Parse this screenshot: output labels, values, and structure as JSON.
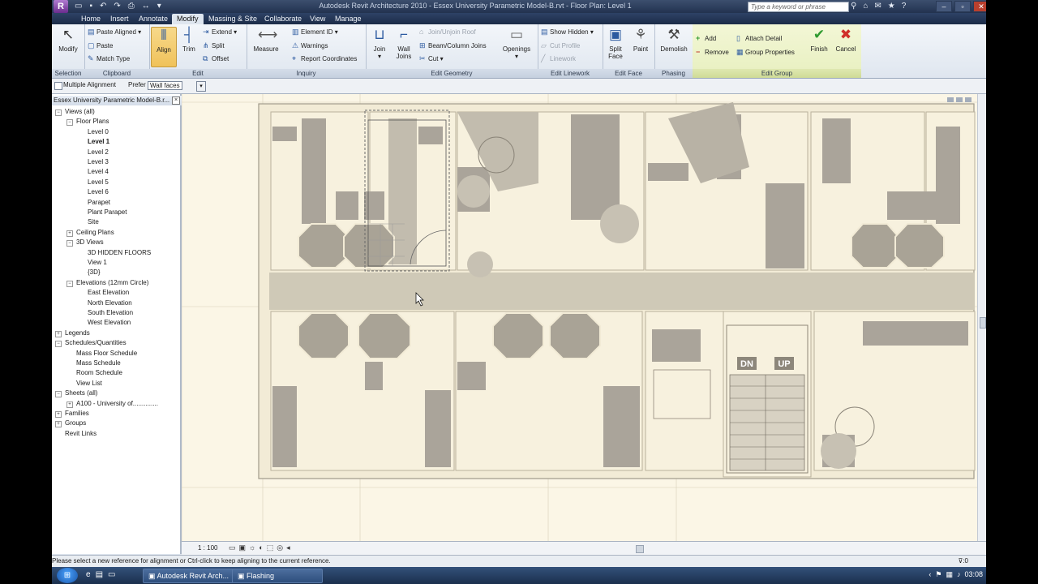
{
  "title_bar": {
    "window_title": "Autodesk Revit Architecture 2010 - Essex University Parametric Model-B.rvt - Floor Plan: Level 1",
    "app_button": "R",
    "search_placeholder": "Type a keyword or phrase",
    "window_controls": [
      "–",
      "▫",
      "✕"
    ]
  },
  "tabs": [
    "Home",
    "Insert",
    "Annotate",
    "Modify",
    "Massing & Site",
    "Collaborate",
    "View",
    "Manage"
  ],
  "active_tab": "Modify",
  "ribbon": {
    "selection": {
      "label": "Selection",
      "modify": "Modify"
    },
    "clipboard": {
      "label": "Clipboard",
      "paste_aligned": "Paste Aligned",
      "paste": "Paste",
      "match_type": "Match Type"
    },
    "edit": {
      "label": "Edit",
      "align": "Align",
      "trim": "Trim",
      "extend": "Extend",
      "split": "Split",
      "offset": "Offset"
    },
    "inquiry": {
      "label": "Inquiry",
      "measure": "Measure",
      "element_id": "Element ID",
      "warnings": "Warnings",
      "report_coordinates": "Report Coordinates"
    },
    "edit_geometry": {
      "label": "Edit Geometry",
      "join": "Join",
      "wall_joins": "Wall Joins",
      "join_unjoin_roof": "Join/Unjoin Roof",
      "beam_column_joins": "Beam/Column Joins",
      "cut": "Cut",
      "openings": "Openings"
    },
    "edit_linework": {
      "label": "Edit Linework",
      "show_hidden": "Show Hidden",
      "cut_profile": "Cut Profile",
      "linework": "Linework"
    },
    "edit_face": {
      "label": "Edit Face",
      "split_face": "Split Face",
      "paint": "Paint"
    },
    "phasing": {
      "label": "Phasing",
      "demolish": "Demolish"
    },
    "edit_group": {
      "label": "Edit Group",
      "add": "Add",
      "remove": "Remove",
      "attach_detail": "Attach Detail",
      "group_properties": "Group Properties",
      "finish": "Finish",
      "cancel": "Cancel"
    }
  },
  "options_bar": {
    "multiple_alignment": "Multiple Alignment",
    "prefer_label": "Prefer",
    "prefer_value": "Wall faces"
  },
  "project_browser": {
    "header": "Essex University Parametric Model-B.r...",
    "items": [
      {
        "label": "Views (all)",
        "level": 0,
        "expander": "−"
      },
      {
        "label": "Floor Plans",
        "level": 1,
        "expander": "−"
      },
      {
        "label": "Level 0",
        "level": 2
      },
      {
        "label": "Level 1",
        "level": 2,
        "bold": true
      },
      {
        "label": "Level 2",
        "level": 2
      },
      {
        "label": "Level 3",
        "level": 2
      },
      {
        "label": "Level 4",
        "level": 2
      },
      {
        "label": "Level 5",
        "level": 2
      },
      {
        "label": "Level 6",
        "level": 2
      },
      {
        "label": "Parapet",
        "level": 2
      },
      {
        "label": "Plant Parapet",
        "level": 2
      },
      {
        "label": "Site",
        "level": 2
      },
      {
        "label": "Ceiling Plans",
        "level": 1,
        "expander": "+"
      },
      {
        "label": "3D Views",
        "level": 1,
        "expander": "−"
      },
      {
        "label": "3D HIDDEN FLOORS",
        "level": 2
      },
      {
        "label": "View 1",
        "level": 2
      },
      {
        "label": "{3D}",
        "level": 2
      },
      {
        "label": "Elevations (12mm Circle)",
        "level": 1,
        "expander": "−"
      },
      {
        "label": "East Elevation",
        "level": 2
      },
      {
        "label": "North Elevation",
        "level": 2
      },
      {
        "label": "South Elevation",
        "level": 2
      },
      {
        "label": "West Elevation",
        "level": 2
      },
      {
        "label": "Legends",
        "level": 0,
        "expander": "+"
      },
      {
        "label": "Schedules/Quantities",
        "level": 0,
        "expander": "−"
      },
      {
        "label": "Mass Floor Schedule",
        "level": 1
      },
      {
        "label": "Mass Schedule",
        "level": 1
      },
      {
        "label": "Room Schedule",
        "level": 1
      },
      {
        "label": "View List",
        "level": 1
      },
      {
        "label": "Sheets (all)",
        "level": 0,
        "expander": "−"
      },
      {
        "label": "A100 - University of..............",
        "level": 1,
        "expander": "+"
      },
      {
        "label": "Families",
        "level": 0,
        "expander": "+"
      },
      {
        "label": "Groups",
        "level": 0,
        "expander": "+"
      },
      {
        "label": "Revit Links",
        "level": 0
      }
    ]
  },
  "drawing": {
    "stair_labels": [
      "DN",
      "UP"
    ]
  },
  "view_bar": {
    "scale": "1 : 100"
  },
  "status_bar": {
    "message": "Please select a new reference for alignment or Ctrl-click to keep aligning to the current reference.",
    "filter_count": ":0"
  },
  "taskbar": {
    "tasks": [
      "Autodesk Revit Arch...",
      "Flashing"
    ],
    "clock": "03:08"
  }
}
